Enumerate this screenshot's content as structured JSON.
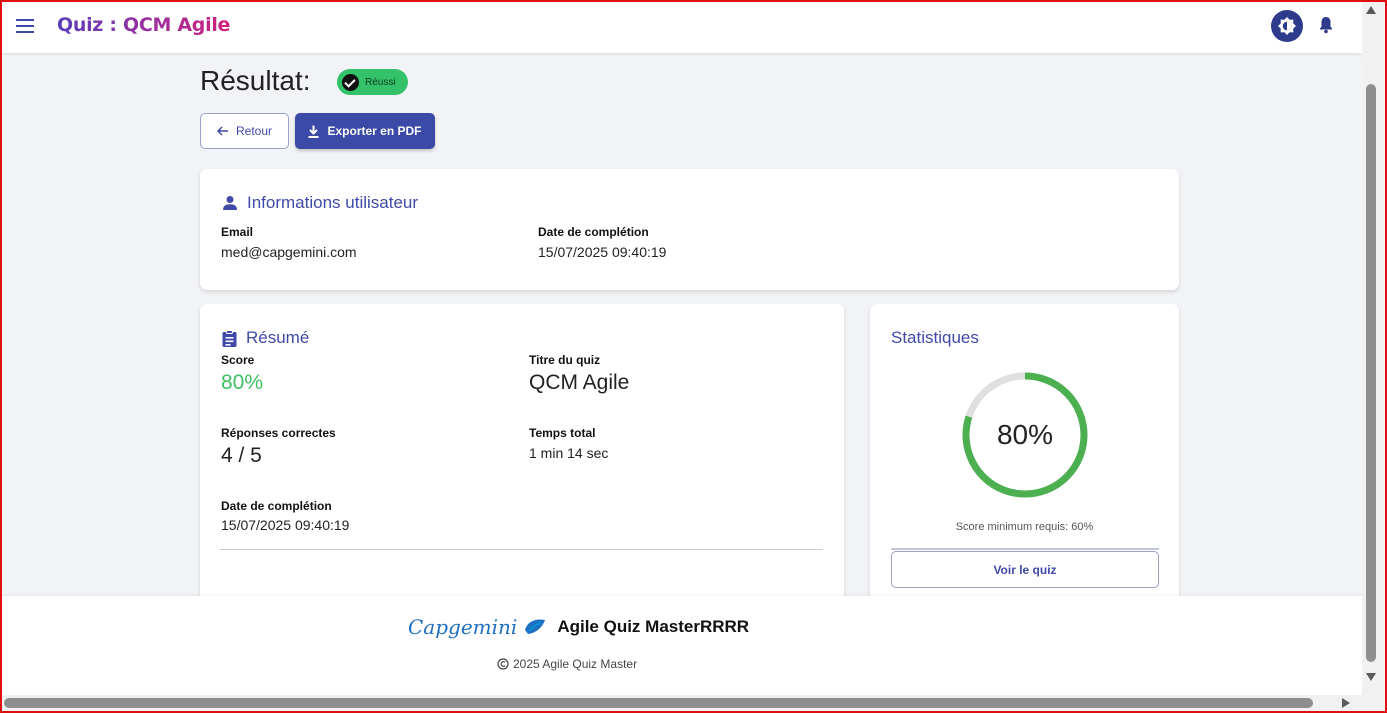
{
  "header": {
    "title": "Quiz : QCM Agile"
  },
  "page": {
    "title": "Résultat:",
    "status_badge": "Réussi",
    "back_label": "Retour",
    "export_label": "Exporter en PDF"
  },
  "user_info": {
    "title": "Informations utilisateur",
    "email_label": "Email",
    "email_value": "med@capgemini.com",
    "date_label": "Date de complétion",
    "date_value": "15/07/2025 09:40:19"
  },
  "summary": {
    "title": "Résumé",
    "score_label": "Score",
    "score_value": "80%",
    "quiz_title_label": "Titre du quiz",
    "quiz_title_value": "QCM Agile",
    "correct_label": "Réponses correctes",
    "correct_value": "4 / 5",
    "time_label": "Temps total",
    "time_value": "1 min 14 sec",
    "date_label": "Date de complétion",
    "date_value": "15/07/2025 09:40:19"
  },
  "stats": {
    "title": "Statistiques",
    "score_percent": "80%",
    "score_fraction": 0.8,
    "min_score_text": "Score minimum requis: 60%",
    "view_quiz_label": "Voir le quiz"
  },
  "footer": {
    "brand_logo": "Capgemini",
    "brand_name": "Agile Quiz MasterRRRR",
    "copyright": "2025 Agile Quiz Master"
  },
  "colors": {
    "primary": "#3b4aa6",
    "success": "#33c26a",
    "ring_progress": "#4caf50",
    "ring_track": "#e0e0e0"
  }
}
